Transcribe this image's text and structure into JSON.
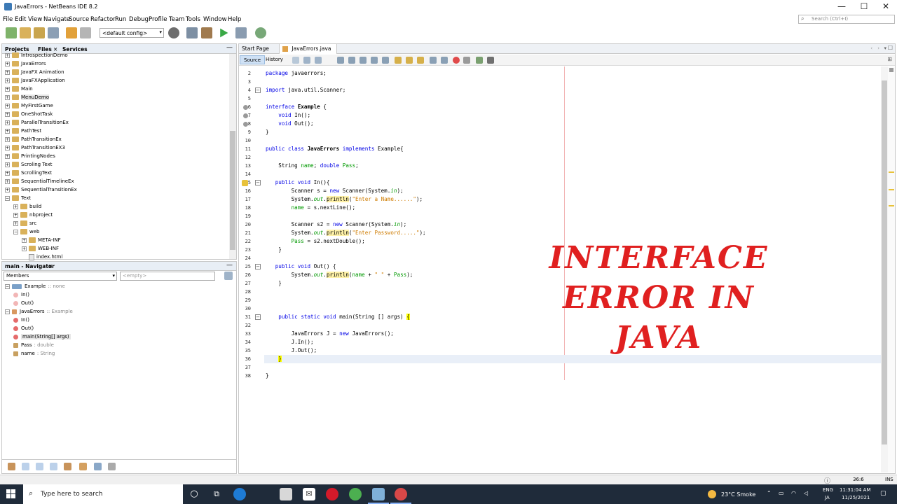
{
  "window": {
    "title": "JavaErrors - NetBeans IDE 8.2",
    "min_glyph": "—",
    "max_glyph": "☐",
    "close_glyph": "✕"
  },
  "menu": [
    "File",
    "Edit",
    "View",
    "Navigate",
    "Source",
    "Refactor",
    "Run",
    "Debug",
    "Profile",
    "Team",
    "Tools",
    "Window",
    "Help"
  ],
  "search": {
    "placeholder": "Search (Ctrl+I)"
  },
  "toolbar": {
    "config": "<default config>"
  },
  "projects_panel": {
    "tabs": [
      "Projects",
      "Files",
      "Services"
    ],
    "close_glyph": "✕",
    "minimize_glyph": "—",
    "tree": [
      {
        "label": "IntrospectionDemo",
        "depth": 0,
        "exp": "+"
      },
      {
        "label": "JavaErrors",
        "depth": 0,
        "exp": "+"
      },
      {
        "label": "JavaFX Animation",
        "depth": 0,
        "exp": "+"
      },
      {
        "label": "JavaFXApplication",
        "depth": 0,
        "exp": "+"
      },
      {
        "label": "Main",
        "depth": 0,
        "exp": "+"
      },
      {
        "label": "MenuDemo",
        "depth": 0,
        "exp": "+"
      },
      {
        "label": "MyFirstGame",
        "depth": 0,
        "exp": "+"
      },
      {
        "label": "OneShotTask",
        "depth": 0,
        "exp": "+"
      },
      {
        "label": "ParallelTransitionEx",
        "depth": 0,
        "exp": "+"
      },
      {
        "label": "PathTest",
        "depth": 0,
        "exp": "+"
      },
      {
        "label": "PathTransitionEx",
        "depth": 0,
        "exp": "+"
      },
      {
        "label": "PathTransitionEX3",
        "depth": 0,
        "exp": "+"
      },
      {
        "label": "PrintingNodes",
        "depth": 0,
        "exp": "+"
      },
      {
        "label": "Scroling Text",
        "depth": 0,
        "exp": "+"
      },
      {
        "label": "ScrollingText",
        "depth": 0,
        "exp": "+"
      },
      {
        "label": "SequentialTimelineEx",
        "depth": 0,
        "exp": "+"
      },
      {
        "label": "SequentialTransitionEx",
        "depth": 0,
        "exp": "+"
      },
      {
        "label": "Text",
        "depth": 0,
        "exp": "−"
      },
      {
        "label": "build",
        "depth": 1,
        "exp": "+"
      },
      {
        "label": "nbproject",
        "depth": 1,
        "exp": "+"
      },
      {
        "label": "src",
        "depth": 1,
        "exp": "+"
      },
      {
        "label": "web",
        "depth": 1,
        "exp": "−"
      },
      {
        "label": "META-INF",
        "depth": 2,
        "exp": "+"
      },
      {
        "label": "WEB-INF",
        "depth": 2,
        "exp": "+"
      },
      {
        "label": "index.html",
        "depth": 2,
        "exp": ""
      }
    ]
  },
  "navigator": {
    "title": "main - Navigator",
    "close_glyph": "✕",
    "minimize_glyph": "—",
    "filter": "Members",
    "filter_value": "<empty>",
    "items": [
      {
        "name": "Example",
        "meta": ":: none",
        "kind": "interface",
        "depth": 0
      },
      {
        "name": "In()",
        "meta": "",
        "kind": "method-abstract",
        "depth": 1
      },
      {
        "name": "Out()",
        "meta": "",
        "kind": "method-abstract",
        "depth": 1
      },
      {
        "name": "JavaErrors",
        "meta": ":: Example",
        "kind": "class",
        "depth": 0
      },
      {
        "name": "In()",
        "meta": "",
        "kind": "method",
        "depth": 1
      },
      {
        "name": "Out()",
        "meta": "",
        "kind": "method",
        "depth": 1
      },
      {
        "name": "main(String[] args)",
        "meta": "",
        "kind": "method-static",
        "depth": 1
      },
      {
        "name": "Pass",
        "meta": ": double",
        "kind": "field",
        "depth": 1
      },
      {
        "name": "name",
        "meta": ": String",
        "kind": "field",
        "depth": 1
      }
    ]
  },
  "editor": {
    "tabs": [
      {
        "label": "Start Page",
        "close": "✕"
      },
      {
        "label": "JavaErrors.java",
        "close": "✕"
      }
    ],
    "source_label": "Source",
    "history_label": "History",
    "code": [
      {
        "n": "2",
        "t": "package javaerrors;"
      },
      {
        "n": "3",
        "t": ""
      },
      {
        "n": "4",
        "t": "import java.util.Scanner;"
      },
      {
        "n": "5",
        "t": ""
      },
      {
        "n": "6",
        "t": "interface Example {"
      },
      {
        "n": "7",
        "t": "    void In();"
      },
      {
        "n": "8",
        "t": "    void Out();"
      },
      {
        "n": "9",
        "t": "}"
      },
      {
        "n": "10",
        "t": ""
      },
      {
        "n": "11",
        "t": "public class JavaErrors implements Example{"
      },
      {
        "n": "12",
        "t": ""
      },
      {
        "n": "13",
        "t": "    String name; double Pass;"
      },
      {
        "n": "14",
        "t": ""
      },
      {
        "n": "15",
        "t": "   public void In(){"
      },
      {
        "n": "16",
        "t": "        Scanner s = new Scanner(System.in);"
      },
      {
        "n": "17",
        "t": "        System.out.println(\"Enter a Name......\");"
      },
      {
        "n": "18",
        "t": "        name = s.nextLine();"
      },
      {
        "n": "19",
        "t": ""
      },
      {
        "n": "20",
        "t": "        Scanner s2 = new Scanner(System.in);"
      },
      {
        "n": "21",
        "t": "        System.out.println(\"Enter Password.....\");"
      },
      {
        "n": "22",
        "t": "        Pass = s2.nextDouble();"
      },
      {
        "n": "23",
        "t": "    }"
      },
      {
        "n": "24",
        "t": ""
      },
      {
        "n": "25",
        "t": "   public void Out() {"
      },
      {
        "n": "26",
        "t": "        System.out.println(name + \" \" + Pass);"
      },
      {
        "n": "27",
        "t": "    }"
      },
      {
        "n": "28",
        "t": ""
      },
      {
        "n": "29",
        "t": ""
      },
      {
        "n": "30",
        "t": ""
      },
      {
        "n": "31",
        "t": "    public static void main(String [] args) {"
      },
      {
        "n": "32",
        "t": ""
      },
      {
        "n": "33",
        "t": "        JavaErrors J = new JavaErrors();"
      },
      {
        "n": "34",
        "t": "        J.In();"
      },
      {
        "n": "35",
        "t": "        J.Out();"
      },
      {
        "n": "36",
        "t": "    }"
      },
      {
        "n": "37",
        "t": ""
      },
      {
        "n": "38",
        "t": "}"
      }
    ]
  },
  "overlay": {
    "line1": "INTERFACE",
    "line2": "ERROR IN",
    "line3": "JAVA"
  },
  "status": {
    "position": "36:6",
    "mode": "INS"
  },
  "taskbar": {
    "search_placeholder": "Type here to search",
    "weather": "23°C  Smoke",
    "lang1": "ENG",
    "lang2": "JA",
    "time": "11:31:04 AM",
    "date": "11/25/2021"
  },
  "colors": {
    "accent": "#e02020",
    "keyword": "#0000e6",
    "string": "#ce7b00",
    "field": "#009900"
  }
}
